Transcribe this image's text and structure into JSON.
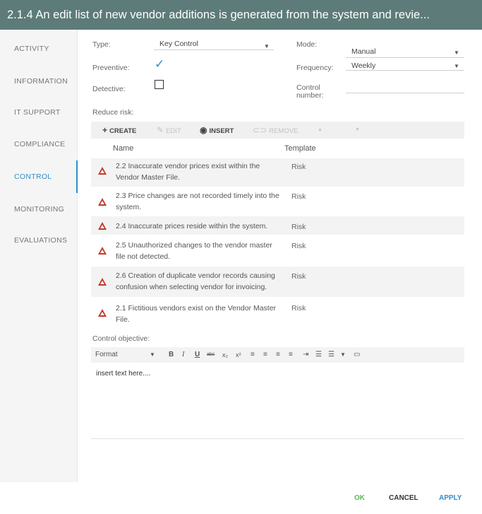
{
  "title": "2.1.4 An edit list of new vendor additions is generated from the system and revie...",
  "sidebar": {
    "items": [
      {
        "label": "ACTIVITY"
      },
      {
        "label": "INFORMATION"
      },
      {
        "label": "IT SUPPORT"
      },
      {
        "label": "COMPLIANCE"
      },
      {
        "label": "CONTROL",
        "active": true
      },
      {
        "label": "MONITORING"
      },
      {
        "label": "EVALUATIONS"
      }
    ]
  },
  "form": {
    "type_label": "Type:",
    "type_value": "Key Control",
    "mode_label": "Mode:",
    "mode_value": "Manual",
    "preventive_label": "Preventive:",
    "preventive_checked": true,
    "frequency_label": "Frequency:",
    "frequency_value": "Weekly",
    "detective_label": "Detective:",
    "detective_checked": false,
    "control_number_label_1": "Control",
    "control_number_label_2": "number:",
    "control_number_value": "",
    "reduce_risk_label": "Reduce risk:"
  },
  "risk_toolbar": {
    "create": "CREATE",
    "edit": "EDIT",
    "insert": "INSERT",
    "remove": "REMOVE",
    "up": "▲",
    "down": "▼"
  },
  "risk_table": {
    "columns": [
      "Name",
      "Template"
    ],
    "rows": [
      {
        "name_1": "2.2 Inaccurate vendor prices exist within the",
        "name_2": "Vendor Master File.",
        "template": "Risk"
      },
      {
        "name_1": "2.3 Price changes are not recorded timely into the",
        "name_2": "system.",
        "template": "Risk"
      },
      {
        "name_1": "2.4 Inaccurate prices reside within the system.",
        "name_2": "",
        "template": "Risk"
      },
      {
        "name_1": "2.5 Unauthorized changes to the vendor master",
        "name_2": "file not detected.",
        "template": "Risk"
      },
      {
        "name_1": "2.6 Creation of duplicate vendor records causing",
        "name_2": "confusion when selecting vendor for invoicing.",
        "template": "Risk"
      },
      {
        "name_1": "2.1 Fictitious vendors exist on the Vendor Master",
        "name_2": "File.",
        "template": "Risk"
      }
    ]
  },
  "objective": {
    "label": "Control objective:",
    "format_label": "Format",
    "bold": "B",
    "italic": "I",
    "underline": "U",
    "strike": "abc",
    "subscript": "x₂",
    "superscript": "x²",
    "content": "insert text here...."
  },
  "footer": {
    "ok": "OK",
    "cancel": "CANCEL",
    "apply": "APPLY"
  },
  "colors": {
    "title_bar": "#5c7b79",
    "accent": "#2f8fc9",
    "warn": "#c0392b",
    "ok": "#5cb85c"
  }
}
